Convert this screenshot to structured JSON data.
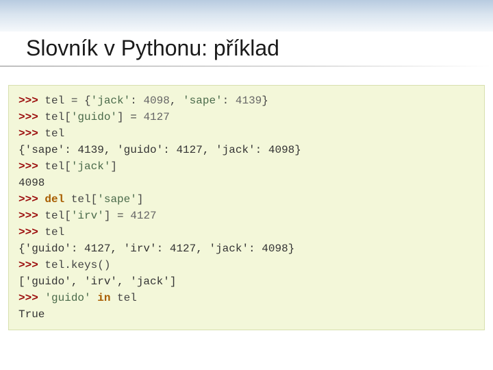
{
  "title": "Slovník v Pythonu: příklad",
  "lines": {
    "l0_prompt": ">>> ",
    "l0_a": "tel = {",
    "l0_s1": "'jack'",
    "l0_b": ": ",
    "l0_n1": "4098",
    "l0_c": ", ",
    "l0_s2": "'sape'",
    "l0_d": ": ",
    "l0_n2": "4139",
    "l0_e": "}",
    "l1_prompt": ">>> ",
    "l1_a": "tel[",
    "l1_s1": "'guido'",
    "l1_b": "] = ",
    "l1_n1": "4127",
    "l2_prompt": ">>> ",
    "l2_a": "tel",
    "l3_out": "{'sape': 4139, 'guido': 4127, 'jack': 4098}",
    "l4_prompt": ">>> ",
    "l4_a": "tel[",
    "l4_s1": "'jack'",
    "l4_b": "]",
    "l5_out": "4098",
    "l6_prompt": ">>> ",
    "l6_kw": "del",
    "l6_a": " tel[",
    "l6_s1": "'sape'",
    "l6_b": "]",
    "l7_prompt": ">>> ",
    "l7_a": "tel[",
    "l7_s1": "'irv'",
    "l7_b": "] = ",
    "l7_n1": "4127",
    "l8_prompt": ">>> ",
    "l8_a": "tel",
    "l9_out": "{'guido': 4127, 'irv': 4127, 'jack': 4098}",
    "l10_prompt": ">>> ",
    "l10_a": "tel.keys()",
    "l11_out": "['guido', 'irv', 'jack']",
    "l12_prompt": ">>> ",
    "l12_s1": "'guido'",
    "l12_a": " ",
    "l12_kw": "in",
    "l12_b": " tel",
    "l13_out": "True"
  }
}
